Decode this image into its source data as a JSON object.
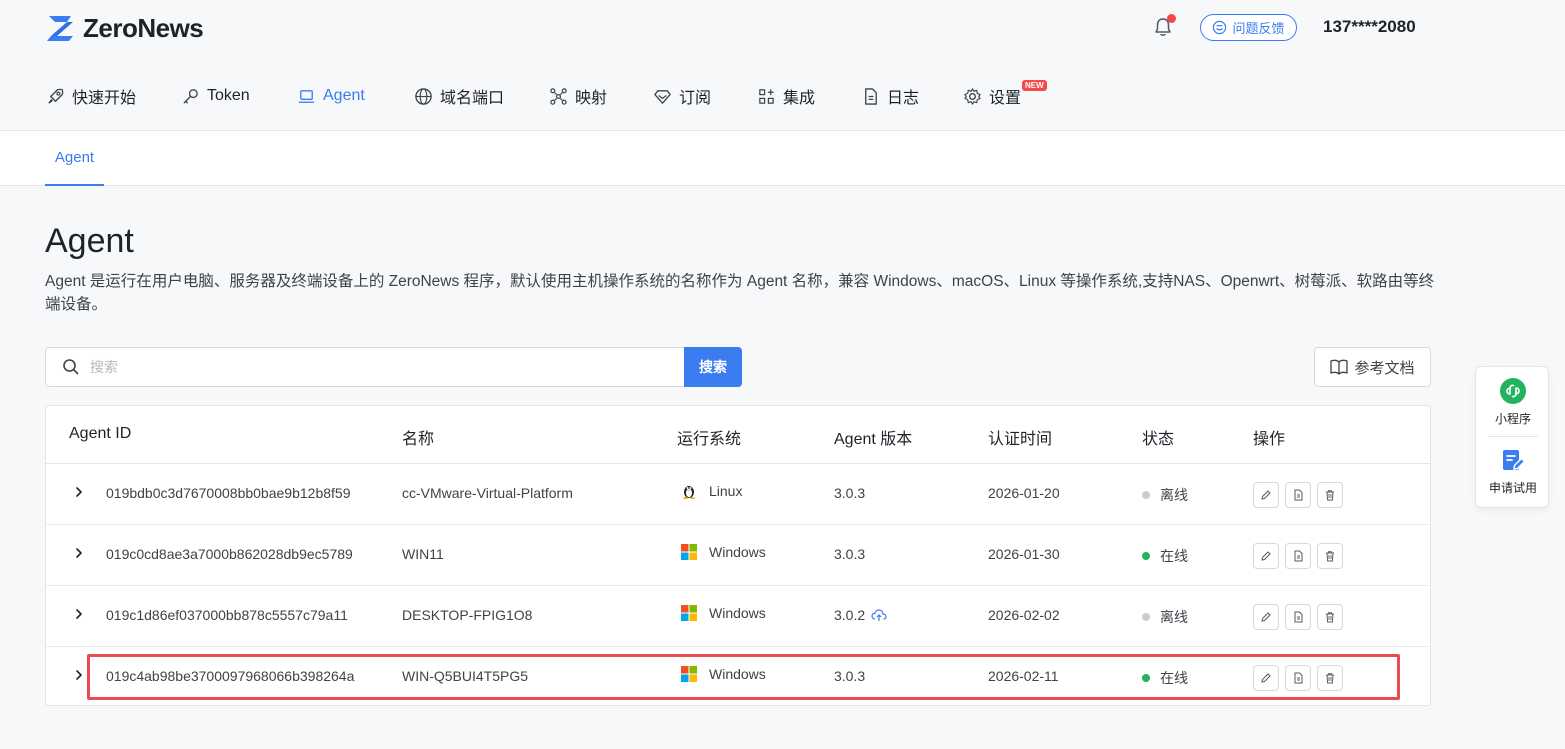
{
  "brand": {
    "name": "ZeroNews",
    "accent": "#3b7cf0"
  },
  "header": {
    "feedback_label": "问题反馈",
    "user_phone": "137****2080"
  },
  "nav": {
    "items": [
      {
        "label": "快速开始",
        "icon": "rocket-icon"
      },
      {
        "label": "Token",
        "icon": "key-icon"
      },
      {
        "label": "Agent",
        "icon": "laptop-icon",
        "active": true
      },
      {
        "label": "域名端口",
        "icon": "globe-icon"
      },
      {
        "label": "映射",
        "icon": "network-icon"
      },
      {
        "label": "订阅",
        "icon": "diamond-icon"
      },
      {
        "label": "集成",
        "icon": "apps-icon"
      },
      {
        "label": "日志",
        "icon": "document-icon"
      },
      {
        "label": "设置",
        "icon": "gear-icon"
      }
    ],
    "new_badge": "NEW"
  },
  "subtabs": {
    "active": "Agent"
  },
  "page": {
    "title": "Agent",
    "description": "Agent 是运行在用户电脑、服务器及终端设备上的 ZeroNews 程序，默认使用主机操作系统的名称作为 Agent 名称，兼容 Windows、macOS、Linux 等操作系统,支持NAS、Openwrt、树莓派、软路由等终端设备。"
  },
  "search": {
    "placeholder": "搜索",
    "value": "",
    "button": "搜索"
  },
  "docs_button": "参考文档",
  "table": {
    "columns": {
      "id": "Agent ID",
      "name": "名称",
      "os": "运行系统",
      "version": "Agent 版本",
      "auth_time": "认证时间",
      "status": "状态",
      "ops": "操作"
    },
    "rows": [
      {
        "id": "019bdb0c3d7670008bb0bae9b12b8f59",
        "name": "cc-VMware-Virtual-Platform",
        "os": "Linux",
        "version": "3.0.3",
        "auth_time": "2026-01-20",
        "status": "离线",
        "online": false,
        "update": false
      },
      {
        "id": "019c0cd8ae3a7000b862028db9ec5789",
        "name": "WIN11",
        "os": "Windows",
        "version": "3.0.3",
        "auth_time": "2026-01-30",
        "status": "在线",
        "online": true,
        "update": false
      },
      {
        "id": "019c1d86ef037000bb878c5557c79a11",
        "name": "DESKTOP-FPIG1O8",
        "os": "Windows",
        "version": "3.0.2",
        "auth_time": "2026-02-02",
        "status": "离线",
        "online": false,
        "update": true
      },
      {
        "id": "019c4ab98be3700097968066b398264a",
        "name": "WIN-Q5BUI4T5PG5",
        "os": "Windows",
        "version": "3.0.3",
        "auth_time": "2026-02-11",
        "status": "在线",
        "online": true,
        "update": false
      }
    ]
  },
  "float": {
    "mini_program": "小程序",
    "trial": "申请试用"
  },
  "colors": {
    "online": "#22b35e",
    "offline": "#c9ccd1",
    "highlight": "#ea4b50"
  }
}
